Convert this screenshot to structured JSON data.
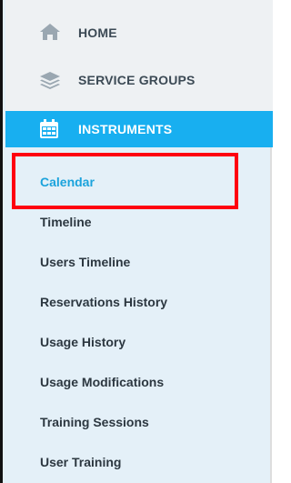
{
  "nav": {
    "home": {
      "label": "HOME",
      "icon": "home-icon"
    },
    "service_groups": {
      "label": "SERVICE GROUPS",
      "icon": "layers-icon"
    },
    "instruments": {
      "label": "INSTRUMENTS",
      "icon": "calendar-icon",
      "active": true
    }
  },
  "submenu": {
    "items": [
      {
        "label": "Calendar",
        "active": true
      },
      {
        "label": "Timeline"
      },
      {
        "label": "Users Timeline"
      },
      {
        "label": "Reservations History"
      },
      {
        "label": "Usage History"
      },
      {
        "label": "Usage Modifications"
      },
      {
        "label": "Training Sessions"
      },
      {
        "label": "User Training"
      }
    ]
  },
  "colors": {
    "accent": "#18aff0",
    "active_text": "#1ba3dc",
    "highlight": "#ff0010",
    "submenu_bg": "#e4f0f8"
  }
}
